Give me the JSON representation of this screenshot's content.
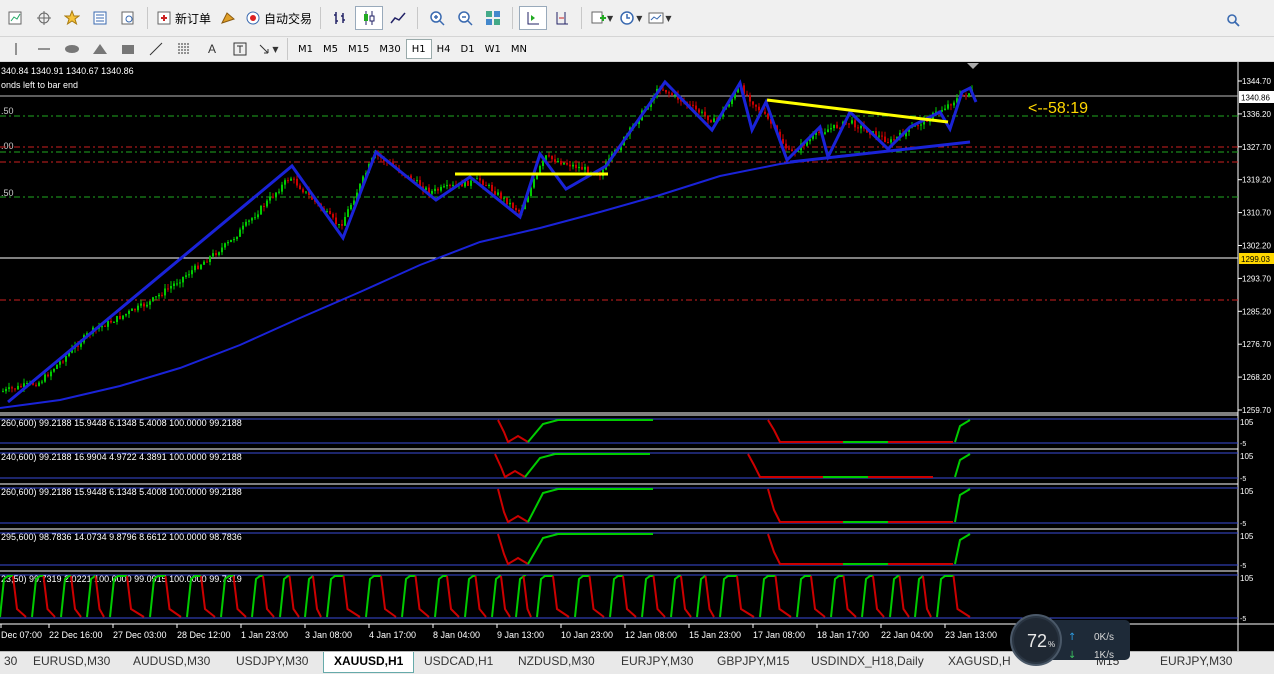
{
  "toolbar": {
    "new_order_label": "新订单",
    "auto_trade_label": "自动交易"
  },
  "timeframes": [
    "M1",
    "M5",
    "M15",
    "M30",
    "H1",
    "H4",
    "D1",
    "W1",
    "MN"
  ],
  "active_timeframe": "H1",
  "chart": {
    "ohlc": "340.84 1340.91 1340.67 1340.86",
    "bar_end_text": "onds left to bar end",
    "countdown": "<--58:19",
    "left_labels": [
      ".50",
      ".00",
      ".50"
    ],
    "price_ticks": [
      "1344.70",
      "1336.20",
      "1327.70",
      "1319.20",
      "1310.70",
      "1302.20",
      "1293.70",
      "1285.20",
      "1276.70",
      "1268.20",
      "1259.70"
    ],
    "current_price": "1340.86",
    "line_price": "1299.03",
    "colors": {
      "ma": "#1a23d8",
      "zigzag": "#1a23d8",
      "trend": "#ffff00",
      "countdown": "#ffd700",
      "bull": "#00cc00",
      "bear": "#cc0000"
    }
  },
  "indicators": [
    {
      "label": "260,600) 99.2188 15.9448 6.1348 5.4008 100.0000 99.2188",
      "top": "105",
      "bottom": "-5"
    },
    {
      "label": "240,600) 99.2188 16.9904 4.9722 4.3891 100.0000 99.2188",
      "top": "105",
      "bottom": "-5"
    },
    {
      "label": "260,600) 99.2188 15.9448 6.1348 5.4008 100.0000 99.2188",
      "top": "105",
      "bottom": "-5"
    },
    {
      "label": "295,600) 98.7836 14.0734 9.8796 8.6612 100.0000 98.7836",
      "top": "105",
      "bottom": "-5"
    },
    {
      "label": "23,50) 99.7319 2.0221 100.0000 99.0915 100.0000 99.7319",
      "top": "105",
      "bottom": "-5"
    }
  ],
  "time_labels": [
    "Dec 07:00",
    "22 Dec 16:00",
    "27 Dec 03:00",
    "28 Dec 12:00",
    "1 Jan 23:00",
    "3 Jan 08:00",
    "4 Jan 17:00",
    "8 Jan 04:00",
    "9 Jan 13:00",
    "10 Jan 23:00",
    "12 Jan 08:00",
    "15 Jan 23:00",
    "17 Jan 08:00",
    "18 Jan 17:00",
    "22 Jan 04:00",
    "23 Jan 13:00"
  ],
  "tabs": [
    "30",
    "EURUSD,M30",
    "AUDUSD,M30",
    "USDJPY,M30",
    "XAUUSD,H1",
    "USDCAD,H1",
    "NZDUSD,M30",
    "EURJPY,M30",
    "GBPJPY,M15",
    "USDINDX_H18,Daily",
    "XAGUSD,H",
    "M15",
    "EURJPY,M30"
  ],
  "selected_tab": "XAUUSD,H1",
  "speed_widget": {
    "percent": "72",
    "percent_sign": "%",
    "upload": "0K/s",
    "download": "1K/s"
  }
}
